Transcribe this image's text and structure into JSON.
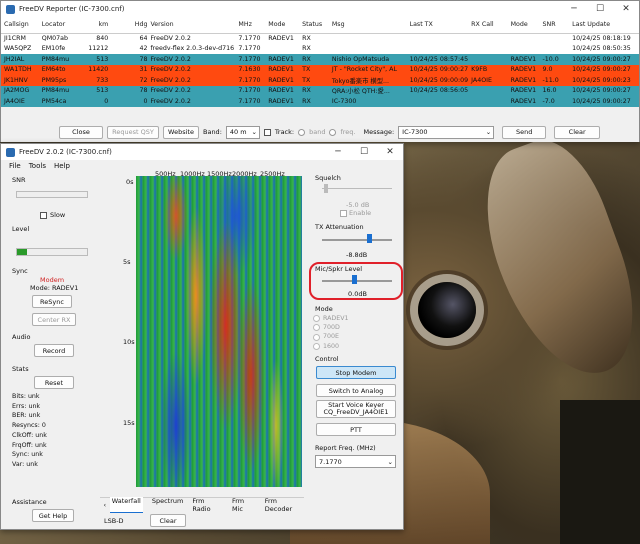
{
  "reporter": {
    "title": "FreeDV Reporter (IC-7300.cnf)",
    "columns": [
      "Callsign",
      "Locator",
      "km",
      "Hdg",
      "Version",
      "MHz",
      "Mode",
      "Status",
      "Msg",
      "Last TX",
      "RX Call",
      "Mode",
      "SNR",
      "Last Update"
    ],
    "rows": [
      {
        "style": "white",
        "cells": [
          "JI1CRM",
          "QM07ab",
          "840",
          "64",
          "FreeDV 2.0.2",
          "7.1770",
          "RADEV1",
          "RX",
          "",
          "",
          "",
          "",
          "",
          "10/24/25 08:18:19"
        ]
      },
      {
        "style": "white",
        "cells": [
          "WA5QPZ",
          "EM10fe",
          "11212",
          "42",
          "freedv-flex 2.0.3-dev-d716",
          "7.1770",
          "",
          "RX",
          "",
          "",
          "",
          "",
          "",
          "10/24/25 08:50:35"
        ]
      },
      {
        "style": "teal",
        "cells": [
          "JH2IAL",
          "PM84mu",
          "513",
          "78",
          "FreeDV 2.0.2",
          "7.1770",
          "RADEV1",
          "RX",
          "Nishio OpMatsuda",
          "10/24/25 08:57:45",
          "",
          "RADEV1",
          "-10.0",
          "10/24/25 09:00:27"
        ]
      },
      {
        "style": "orange",
        "cells": [
          "WA1TDH",
          "EM64to",
          "11420",
          "31",
          "FreeDV 2.0.2",
          "7.1630",
          "RADEV1",
          "TX",
          "JT - \"Rocket City\", AL",
          "10/24/25 09:00:27",
          "K9FB",
          "RADEV1",
          "9.0",
          "10/24/25 09:00:27"
        ]
      },
      {
        "style": "orange",
        "cells": [
          "JK1HNV",
          "PM95ps",
          "733",
          "72",
          "FreeDV 2.0.2",
          "7.1770",
          "RADEV1",
          "TX",
          "Tokyo番楽市 横型...",
          "10/24/25 09:00:09",
          "JA4OIE",
          "RADEV1",
          "-11.0",
          "10/24/25 09:00:23"
        ]
      },
      {
        "style": "teal",
        "cells": [
          "JA2MOG",
          "PM84mu",
          "513",
          "78",
          "FreeDV 2.0.2",
          "7.1770",
          "RADEV1",
          "RX",
          "QRA:小松 QTH:愛...",
          "10/24/25 08:56:05",
          "",
          "RADEV1",
          "16.0",
          "10/24/25 09:00:27"
        ]
      },
      {
        "style": "teal",
        "cells": [
          "JA4OIE",
          "PM54ca",
          "0",
          "0",
          "FreeDV 2.0.2",
          "7.1770",
          "RADEV1",
          "RX",
          "IC-7300",
          "",
          "",
          "RADEV1",
          "-7.0",
          "10/24/25 09:00:27"
        ]
      }
    ],
    "close": "Close",
    "request_qsy": "Request QSY",
    "website": "Website",
    "band_label": "Band:",
    "band_value": "40 m",
    "track_label": "Track:",
    "band_radio": "band",
    "freq_radio": "freq.",
    "message_label": "Message:",
    "message_value": "IC-7300",
    "send": "Send",
    "clear": "Clear"
  },
  "freedv": {
    "title": "FreeDV 2.0.2 (IC-7300.cnf)",
    "menu": [
      "File",
      "Tools",
      "Help"
    ],
    "snr_label": "SNR",
    "snr_value": "--",
    "slow_label": "Slow",
    "level_label": "Level",
    "sync_label": "Sync",
    "modem_status": "Modem",
    "mode_text": "Mode: RADEV1",
    "resync": "ReSync",
    "center_rx": "Center RX",
    "audio_label": "Audio",
    "record": "Record",
    "stats_label": "Stats",
    "reset": "Reset",
    "stats": [
      "Bits: unk",
      "Errs: unk",
      "BER: unk",
      "Resyncs: 0",
      "ClkOff: unk",
      "FrqOff: unk",
      "Sync: unk",
      "Var: unk"
    ],
    "assistance_label": "Assistance",
    "get_help": "Get Help",
    "freq_ticks": [
      "500Hz",
      "1000Hz",
      "1500Hz",
      "2000Hz",
      "2500Hz"
    ],
    "time_ticks": [
      "0s",
      "5s",
      "10s",
      "15s"
    ],
    "tabs": [
      "Waterfall",
      "Spectrum",
      "Frm Radio",
      "Frm Mic",
      "Frm Decoder"
    ],
    "lsb_label": "LSB-D",
    "clear": "Clear",
    "squelch_label": "Squelch",
    "squelch_value": "-5.0 dB",
    "enable_label": "Enable",
    "tx_atten_label": "TX Attenuation",
    "tx_atten_value": "-8.8dB",
    "mic_label": "Mic/Spkr Level",
    "mic_value": "0.0dB",
    "mode_label": "Mode",
    "modes": [
      "RADEV1",
      "700D",
      "700E",
      "1600"
    ],
    "control_label": "Control",
    "stop_modem": "Stop Modem",
    "switch_analog": "Switch to Analog",
    "voice_keyer": "Start Voice Keyer",
    "voice_keyer_file": "CQ_FreeDV_JA4OIE1",
    "ptt": "PTT",
    "report_freq_label": "Report Freq. (MHz)",
    "report_freq_value": "7.1770"
  },
  "colors": {
    "teal": "#3aa0b0",
    "orange": "#ff4a10",
    "highlight": "#e0202a"
  }
}
